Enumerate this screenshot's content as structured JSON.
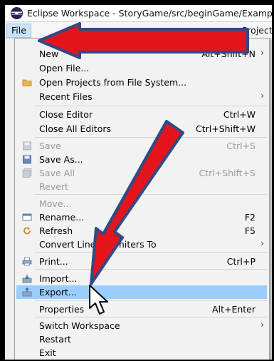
{
  "window": {
    "title": "Eclipse Workspace - StoryGame/src/beginGame/Example"
  },
  "menubar": {
    "file": "File",
    "project": "Project"
  },
  "menu": {
    "new": {
      "label": "New",
      "shortcut": "Alt+Shift+N"
    },
    "open_file": {
      "label": "Open File..."
    },
    "open_proj": {
      "label": "Open Projects from File System..."
    },
    "recent": {
      "label": "Recent Files"
    },
    "close_ed": {
      "label": "Close Editor",
      "shortcut": "Ctrl+W"
    },
    "close_all": {
      "label": "Close All Editors",
      "shortcut": "Ctrl+Shift+W"
    },
    "save": {
      "label": "Save",
      "shortcut": "Ctrl+S"
    },
    "save_as": {
      "label": "Save As..."
    },
    "save_all": {
      "label": "Save All",
      "shortcut": "Ctrl+Shift+S"
    },
    "revert": {
      "label": "Revert"
    },
    "move": {
      "label": "Move..."
    },
    "rename": {
      "label": "Rename...",
      "shortcut": "F2"
    },
    "refresh": {
      "label": "Refresh",
      "shortcut": "F5"
    },
    "convert": {
      "label": "Convert Line Delimiters To"
    },
    "print": {
      "label": "Print...",
      "shortcut": "Ctrl+P"
    },
    "import": {
      "label": "Import..."
    },
    "export": {
      "label": "Export..."
    },
    "properties": {
      "label": "Properties",
      "shortcut": "Alt+Enter"
    },
    "switch_ws": {
      "label": "Switch Workspace"
    },
    "restart": {
      "label": "Restart"
    },
    "exit": {
      "label": "Exit"
    }
  },
  "submenu_glyph": "›",
  "colors": {
    "arrow_fill": "#e3141b",
    "arrow_outline": "#2d4b86",
    "highlight": "#99ccff"
  }
}
